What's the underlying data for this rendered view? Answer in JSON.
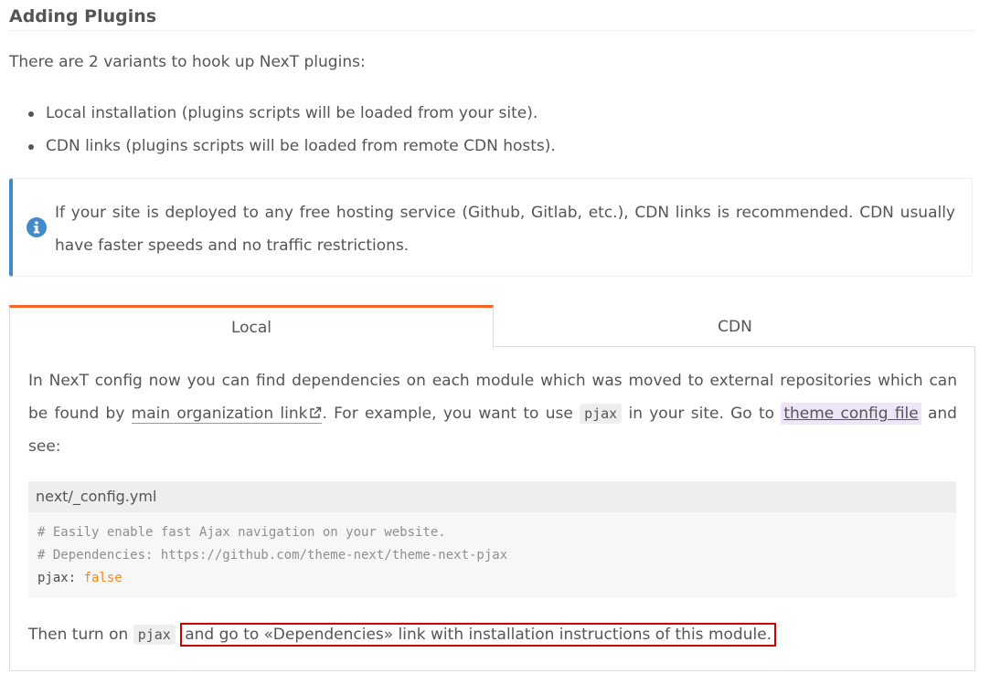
{
  "heading": "Adding Plugins",
  "intro": "There are 2 variants to hook up NexT plugins:",
  "bullets": [
    "Local installation (plugins scripts will be loaded from your site).",
    "CDN links (plugins scripts will be loaded from remote CDN hosts)."
  ],
  "note": {
    "icon": "info-circle-icon",
    "text": "If your site is deployed to any free hosting service (Github, Gitlab, etc.), CDN links is recommended. CDN usually have faster speeds and no traffic restrictions."
  },
  "tabs": {
    "local": "Local",
    "cdn": "CDN"
  },
  "panel": {
    "p1_a": "In NexT config now you can find dependencies on each module which was moved to external repositories which can be found by ",
    "link": "main organization link",
    "p1_b": ". For example, you want to use ",
    "code_pjax": "pjax",
    "p1_c": " in your site. Go to ",
    "theme_link": "theme config file",
    "p1_d": " and see:",
    "code_caption": "next/_config.yml",
    "code_line1": "# Easily enable fast Ajax navigation on your website.",
    "code_line2": "# Dependencies: https://github.com/theme-next/theme-next-pjax",
    "code_key": "pjax",
    "code_colon": ": ",
    "code_value": "false",
    "final_a": "Then turn on ",
    "final_code": "pjax",
    "final_b": "and go to «Dependencies» link with installation instructions of this module."
  },
  "colors": {
    "accent": "#fc6423",
    "note_border": "#428bca",
    "highlight_box": "#cc0000"
  }
}
